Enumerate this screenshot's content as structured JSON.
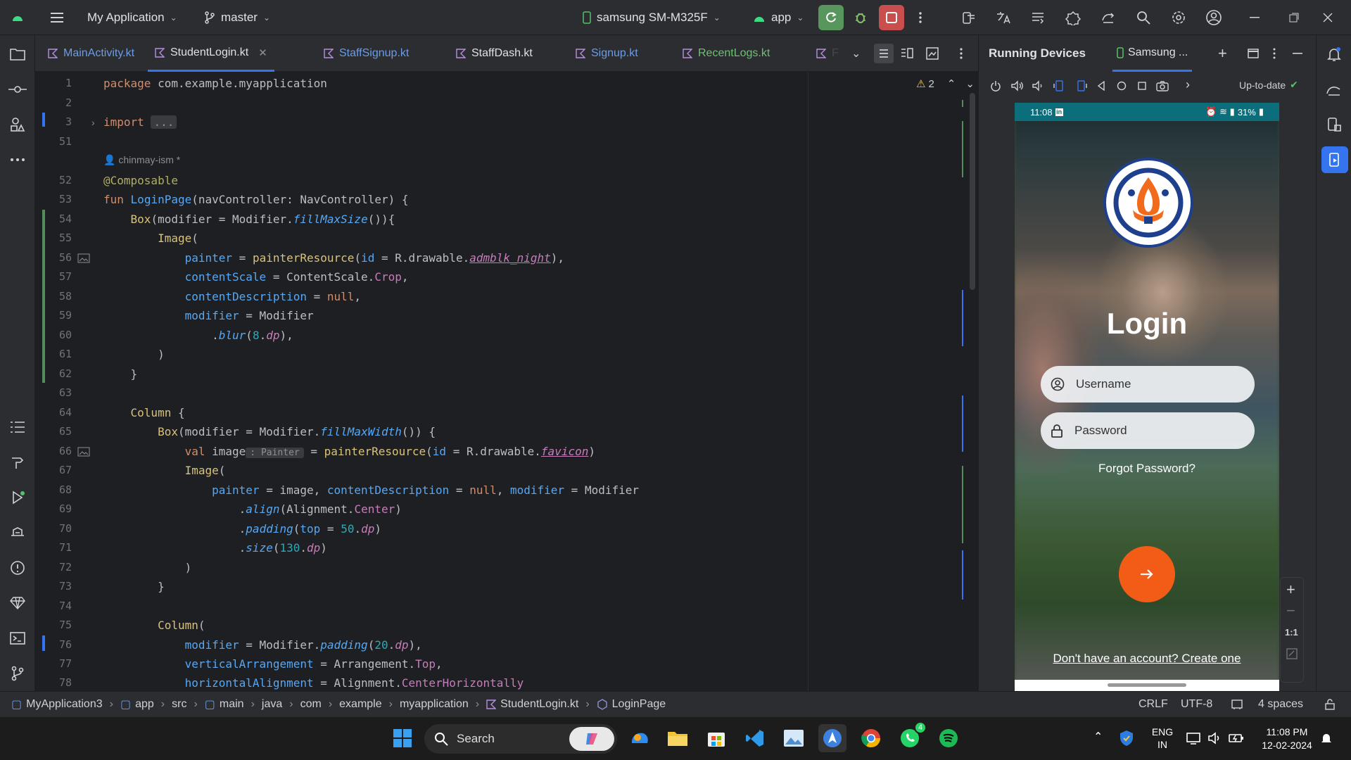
{
  "titlebar": {
    "project": "My Application",
    "branch": "master",
    "device": "samsung SM-M325F",
    "run_config": "app"
  },
  "tabs": [
    {
      "label": "MainActivity.kt"
    },
    {
      "label": "StudentLogin.kt"
    },
    {
      "label": "StaffSignup.kt"
    },
    {
      "label": "StaffDash.kt"
    },
    {
      "label": "Signup.kt"
    },
    {
      "label": "RecentLogs.kt"
    },
    {
      "label": "F"
    }
  ],
  "editor": {
    "warnings": "2",
    "author_hint": "chinmay-ism *",
    "type_hint": ": Painter",
    "fold_text": "...",
    "line_numbers": [
      "1",
      "2",
      "3",
      "51",
      "",
      "52",
      "53",
      "54",
      "55",
      "56",
      "57",
      "58",
      "59",
      "60",
      "61",
      "62",
      "63",
      "64",
      "65",
      "66",
      "67",
      "68",
      "69",
      "70",
      "71",
      "72",
      "73",
      "74",
      "75",
      "76",
      "77",
      "78"
    ]
  },
  "running_devices": {
    "title": "Running Devices",
    "device_tab": "Samsung ...",
    "status": "Up-to-date"
  },
  "phone": {
    "time": "11:08",
    "battery": "31%",
    "login_title": "Login",
    "username_placeholder": "Username",
    "password_placeholder": "Password",
    "forgot": "Forgot Password?",
    "signup": "Don't have an account? Create one",
    "zoom_label": "1:1"
  },
  "breadcrumb": [
    "MyApplication3",
    "app",
    "src",
    "main",
    "java",
    "com",
    "example",
    "myapplication",
    "StudentLogin.kt",
    "LoginPage"
  ],
  "status_right": {
    "line_sep": "CRLF",
    "encoding": "UTF-8",
    "indent": "4 spaces"
  },
  "taskbar": {
    "search": "Search",
    "lang1": "ENG",
    "lang2": "IN",
    "time": "11:08 PM",
    "date": "12-02-2024",
    "whatsapp_badge": "4"
  },
  "colors": {
    "accent": "#3574f0",
    "run": "#57965c",
    "stop": "#c94f4f",
    "login_button": "#f25c16"
  }
}
